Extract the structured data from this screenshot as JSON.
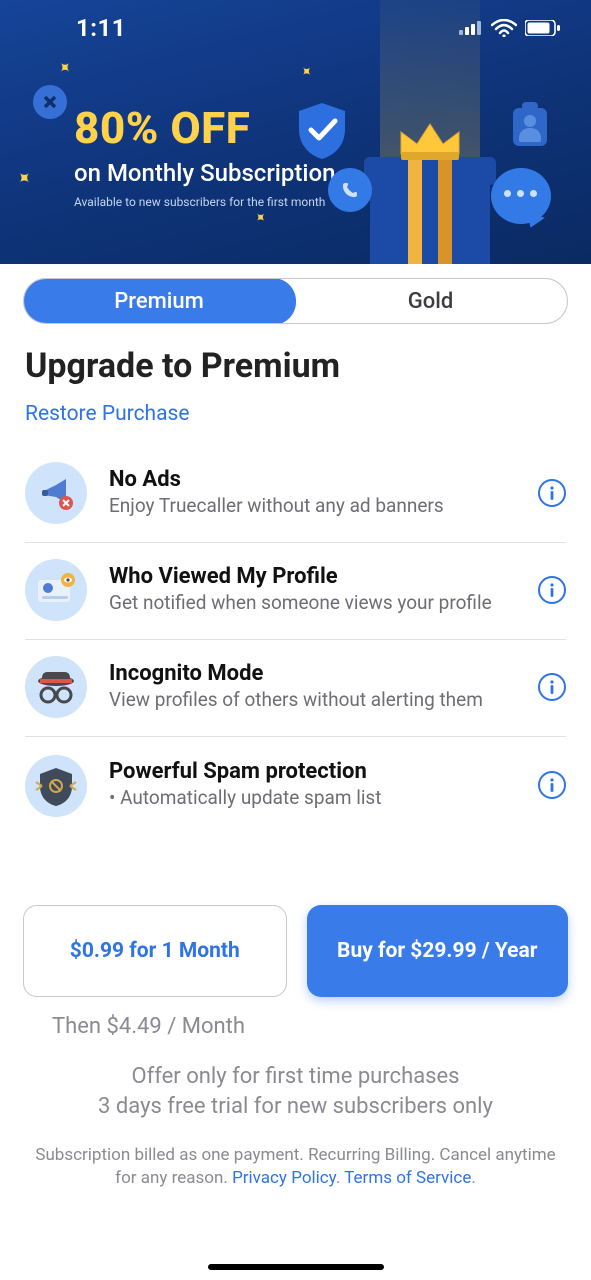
{
  "status": {
    "time": "1:11"
  },
  "hero": {
    "headline": "80% OFF",
    "subtitle": "on Monthly Subscription",
    "fineprint": "Available to new subscribers for the first month"
  },
  "tabs": {
    "premium": "Premium",
    "gold": "Gold"
  },
  "page_title": "Upgrade to Premium",
  "restore": "Restore Purchase",
  "features": [
    {
      "title": "No Ads",
      "desc": "Enjoy Truecaller without any ad banners"
    },
    {
      "title": "Who Viewed My Profile",
      "desc": "Get notified when someone views your profile"
    },
    {
      "title": "Incognito Mode",
      "desc": "View profiles of others without alerting them"
    },
    {
      "title": "Powerful Spam protection",
      "desc": " •  Automatically update spam list"
    }
  ],
  "pricing": {
    "month_label": "$0.99 for 1 Month",
    "year_label": "Buy for $29.99 / Year",
    "then": "Then $4.49 / Month"
  },
  "offer_line1": "Offer only for first time purchases",
  "offer_line2": "3 days free trial for new subscribers only",
  "legal": {
    "text1": "Subscription billed as one payment. Recurring Billing. Cancel anytime for any reason. ",
    "privacy": "Privacy Policy",
    "dot": ". ",
    "terms": "Terms of Service",
    "end": "."
  }
}
